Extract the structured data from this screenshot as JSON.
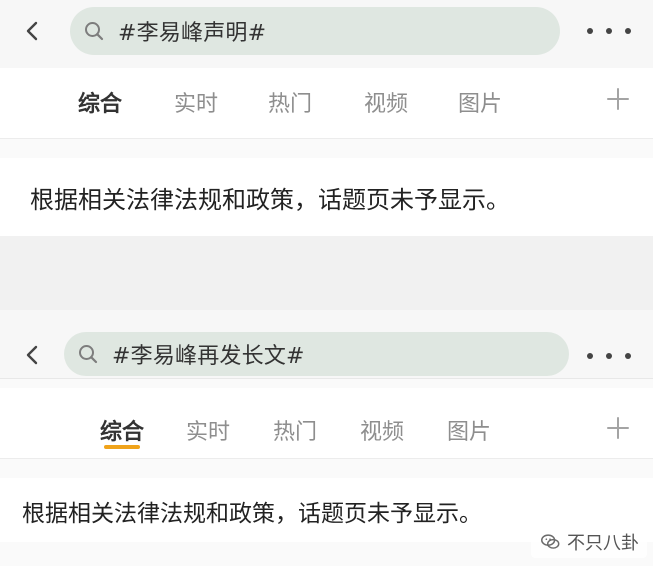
{
  "screens": [
    {
      "search_text": "#李易峰声明#",
      "tabs": [
        {
          "label": "综合",
          "active": true
        },
        {
          "label": "实时",
          "active": false
        },
        {
          "label": "热门",
          "active": false
        },
        {
          "label": "视频",
          "active": false
        },
        {
          "label": "图片",
          "active": false
        }
      ],
      "notice": "根据相关法律法规和政策，话题页未予显示。"
    },
    {
      "search_text": "#李易峰再发长文#",
      "tabs": [
        {
          "label": "综合",
          "active": true
        },
        {
          "label": "实时",
          "active": false
        },
        {
          "label": "热门",
          "active": false
        },
        {
          "label": "视频",
          "active": false
        },
        {
          "label": "图片",
          "active": false
        }
      ],
      "notice": "根据相关法律法规和政策，话题页未予显示。"
    }
  ],
  "watermark": {
    "text": "不只八卦"
  },
  "colors": {
    "accent": "#f0a31a",
    "search_bg": "#dfe7e1"
  }
}
